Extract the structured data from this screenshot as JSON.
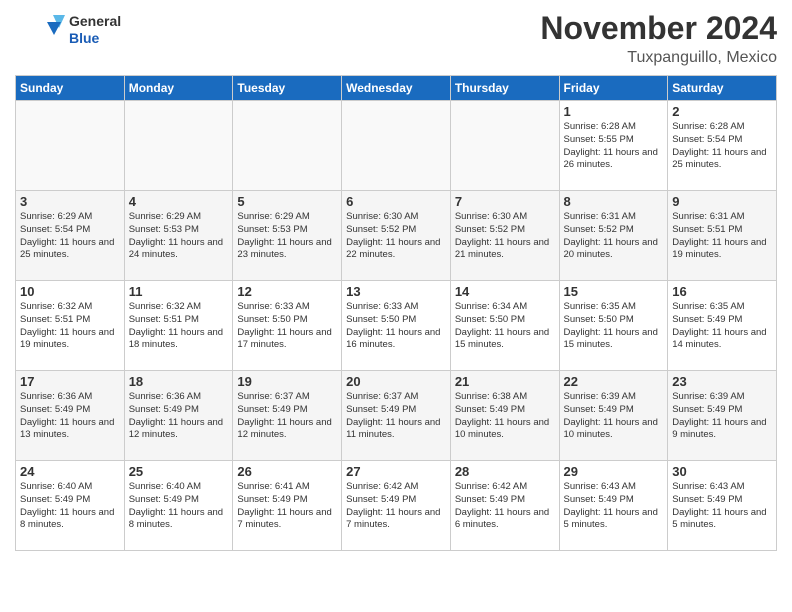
{
  "header": {
    "logo_line1": "General",
    "logo_line2": "Blue",
    "month_title": "November 2024",
    "location": "Tuxpanguillo, Mexico"
  },
  "weekdays": [
    "Sunday",
    "Monday",
    "Tuesday",
    "Wednesday",
    "Thursday",
    "Friday",
    "Saturday"
  ],
  "weeks": [
    [
      {
        "day": "",
        "sunrise": "",
        "sunset": "",
        "daylight": ""
      },
      {
        "day": "",
        "sunrise": "",
        "sunset": "",
        "daylight": ""
      },
      {
        "day": "",
        "sunrise": "",
        "sunset": "",
        "daylight": ""
      },
      {
        "day": "",
        "sunrise": "",
        "sunset": "",
        "daylight": ""
      },
      {
        "day": "",
        "sunrise": "",
        "sunset": "",
        "daylight": ""
      },
      {
        "day": "1",
        "sunrise": "Sunrise: 6:28 AM",
        "sunset": "Sunset: 5:55 PM",
        "daylight": "Daylight: 11 hours and 26 minutes."
      },
      {
        "day": "2",
        "sunrise": "Sunrise: 6:28 AM",
        "sunset": "Sunset: 5:54 PM",
        "daylight": "Daylight: 11 hours and 25 minutes."
      }
    ],
    [
      {
        "day": "3",
        "sunrise": "Sunrise: 6:29 AM",
        "sunset": "Sunset: 5:54 PM",
        "daylight": "Daylight: 11 hours and 25 minutes."
      },
      {
        "day": "4",
        "sunrise": "Sunrise: 6:29 AM",
        "sunset": "Sunset: 5:53 PM",
        "daylight": "Daylight: 11 hours and 24 minutes."
      },
      {
        "day": "5",
        "sunrise": "Sunrise: 6:29 AM",
        "sunset": "Sunset: 5:53 PM",
        "daylight": "Daylight: 11 hours and 23 minutes."
      },
      {
        "day": "6",
        "sunrise": "Sunrise: 6:30 AM",
        "sunset": "Sunset: 5:52 PM",
        "daylight": "Daylight: 11 hours and 22 minutes."
      },
      {
        "day": "7",
        "sunrise": "Sunrise: 6:30 AM",
        "sunset": "Sunset: 5:52 PM",
        "daylight": "Daylight: 11 hours and 21 minutes."
      },
      {
        "day": "8",
        "sunrise": "Sunrise: 6:31 AM",
        "sunset": "Sunset: 5:52 PM",
        "daylight": "Daylight: 11 hours and 20 minutes."
      },
      {
        "day": "9",
        "sunrise": "Sunrise: 6:31 AM",
        "sunset": "Sunset: 5:51 PM",
        "daylight": "Daylight: 11 hours and 19 minutes."
      }
    ],
    [
      {
        "day": "10",
        "sunrise": "Sunrise: 6:32 AM",
        "sunset": "Sunset: 5:51 PM",
        "daylight": "Daylight: 11 hours and 19 minutes."
      },
      {
        "day": "11",
        "sunrise": "Sunrise: 6:32 AM",
        "sunset": "Sunset: 5:51 PM",
        "daylight": "Daylight: 11 hours and 18 minutes."
      },
      {
        "day": "12",
        "sunrise": "Sunrise: 6:33 AM",
        "sunset": "Sunset: 5:50 PM",
        "daylight": "Daylight: 11 hours and 17 minutes."
      },
      {
        "day": "13",
        "sunrise": "Sunrise: 6:33 AM",
        "sunset": "Sunset: 5:50 PM",
        "daylight": "Daylight: 11 hours and 16 minutes."
      },
      {
        "day": "14",
        "sunrise": "Sunrise: 6:34 AM",
        "sunset": "Sunset: 5:50 PM",
        "daylight": "Daylight: 11 hours and 15 minutes."
      },
      {
        "day": "15",
        "sunrise": "Sunrise: 6:35 AM",
        "sunset": "Sunset: 5:50 PM",
        "daylight": "Daylight: 11 hours and 15 minutes."
      },
      {
        "day": "16",
        "sunrise": "Sunrise: 6:35 AM",
        "sunset": "Sunset: 5:49 PM",
        "daylight": "Daylight: 11 hours and 14 minutes."
      }
    ],
    [
      {
        "day": "17",
        "sunrise": "Sunrise: 6:36 AM",
        "sunset": "Sunset: 5:49 PM",
        "daylight": "Daylight: 11 hours and 13 minutes."
      },
      {
        "day": "18",
        "sunrise": "Sunrise: 6:36 AM",
        "sunset": "Sunset: 5:49 PM",
        "daylight": "Daylight: 11 hours and 12 minutes."
      },
      {
        "day": "19",
        "sunrise": "Sunrise: 6:37 AM",
        "sunset": "Sunset: 5:49 PM",
        "daylight": "Daylight: 11 hours and 12 minutes."
      },
      {
        "day": "20",
        "sunrise": "Sunrise: 6:37 AM",
        "sunset": "Sunset: 5:49 PM",
        "daylight": "Daylight: 11 hours and 11 minutes."
      },
      {
        "day": "21",
        "sunrise": "Sunrise: 6:38 AM",
        "sunset": "Sunset: 5:49 PM",
        "daylight": "Daylight: 11 hours and 10 minutes."
      },
      {
        "day": "22",
        "sunrise": "Sunrise: 6:39 AM",
        "sunset": "Sunset: 5:49 PM",
        "daylight": "Daylight: 11 hours and 10 minutes."
      },
      {
        "day": "23",
        "sunrise": "Sunrise: 6:39 AM",
        "sunset": "Sunset: 5:49 PM",
        "daylight": "Daylight: 11 hours and 9 minutes."
      }
    ],
    [
      {
        "day": "24",
        "sunrise": "Sunrise: 6:40 AM",
        "sunset": "Sunset: 5:49 PM",
        "daylight": "Daylight: 11 hours and 8 minutes."
      },
      {
        "day": "25",
        "sunrise": "Sunrise: 6:40 AM",
        "sunset": "Sunset: 5:49 PM",
        "daylight": "Daylight: 11 hours and 8 minutes."
      },
      {
        "day": "26",
        "sunrise": "Sunrise: 6:41 AM",
        "sunset": "Sunset: 5:49 PM",
        "daylight": "Daylight: 11 hours and 7 minutes."
      },
      {
        "day": "27",
        "sunrise": "Sunrise: 6:42 AM",
        "sunset": "Sunset: 5:49 PM",
        "daylight": "Daylight: 11 hours and 7 minutes."
      },
      {
        "day": "28",
        "sunrise": "Sunrise: 6:42 AM",
        "sunset": "Sunset: 5:49 PM",
        "daylight": "Daylight: 11 hours and 6 minutes."
      },
      {
        "day": "29",
        "sunrise": "Sunrise: 6:43 AM",
        "sunset": "Sunset: 5:49 PM",
        "daylight": "Daylight: 11 hours and 5 minutes."
      },
      {
        "day": "30",
        "sunrise": "Sunrise: 6:43 AM",
        "sunset": "Sunset: 5:49 PM",
        "daylight": "Daylight: 11 hours and 5 minutes."
      }
    ]
  ]
}
